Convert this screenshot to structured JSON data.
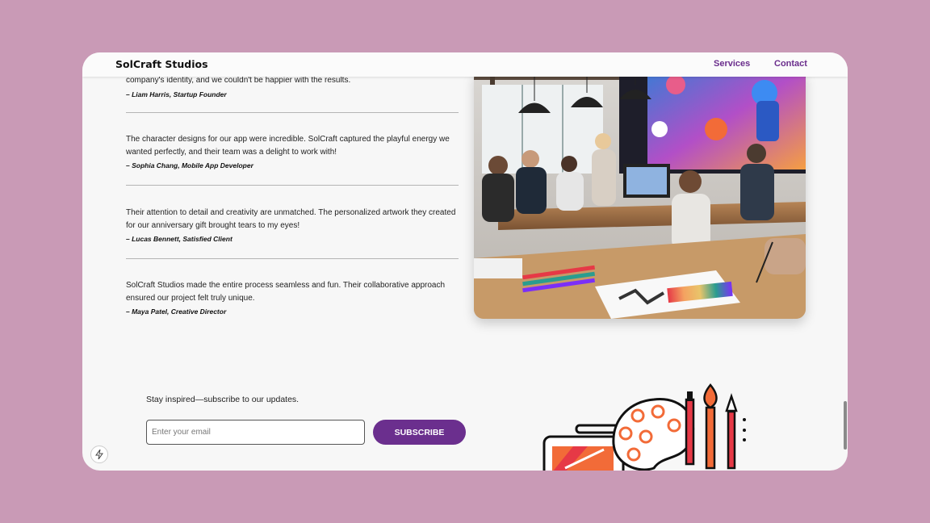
{
  "nav": {
    "brand": "SolCraft Studios",
    "links": [
      "Services",
      "Contact"
    ]
  },
  "testimonials": [
    {
      "quote": "company's identity, and we couldn't be happier with the results.",
      "author": "– Liam Harris, Startup Founder"
    },
    {
      "quote": "The character designs for our app were incredible. SolCraft captured the playful energy we wanted perfectly, and their team was a delight to work with!",
      "author": "– Sophia Chang, Mobile App Developer"
    },
    {
      "quote": "Their attention to detail and creativity are unmatched. The personalized artwork they created for our anniversary gift brought tears to my eyes!",
      "author": "– Lucas Bennett, Satisfied Client"
    },
    {
      "quote": "SolCraft Studios made the entire process seamless and fun. Their collaborative approach ensured our project felt truly unique.",
      "author": "– Maya Patel, Creative Director"
    }
  ],
  "newsletter": {
    "text": "Stay inspired—subscribe to our updates.",
    "email_placeholder": "Enter your email",
    "button_label": "SUBSCRIBE"
  },
  "icons": {
    "bolt": "lightning-bolt-icon",
    "art": "art-supplies-icon"
  },
  "colors": {
    "accent": "#6b2f8e",
    "page_background": "#c99ab6"
  }
}
